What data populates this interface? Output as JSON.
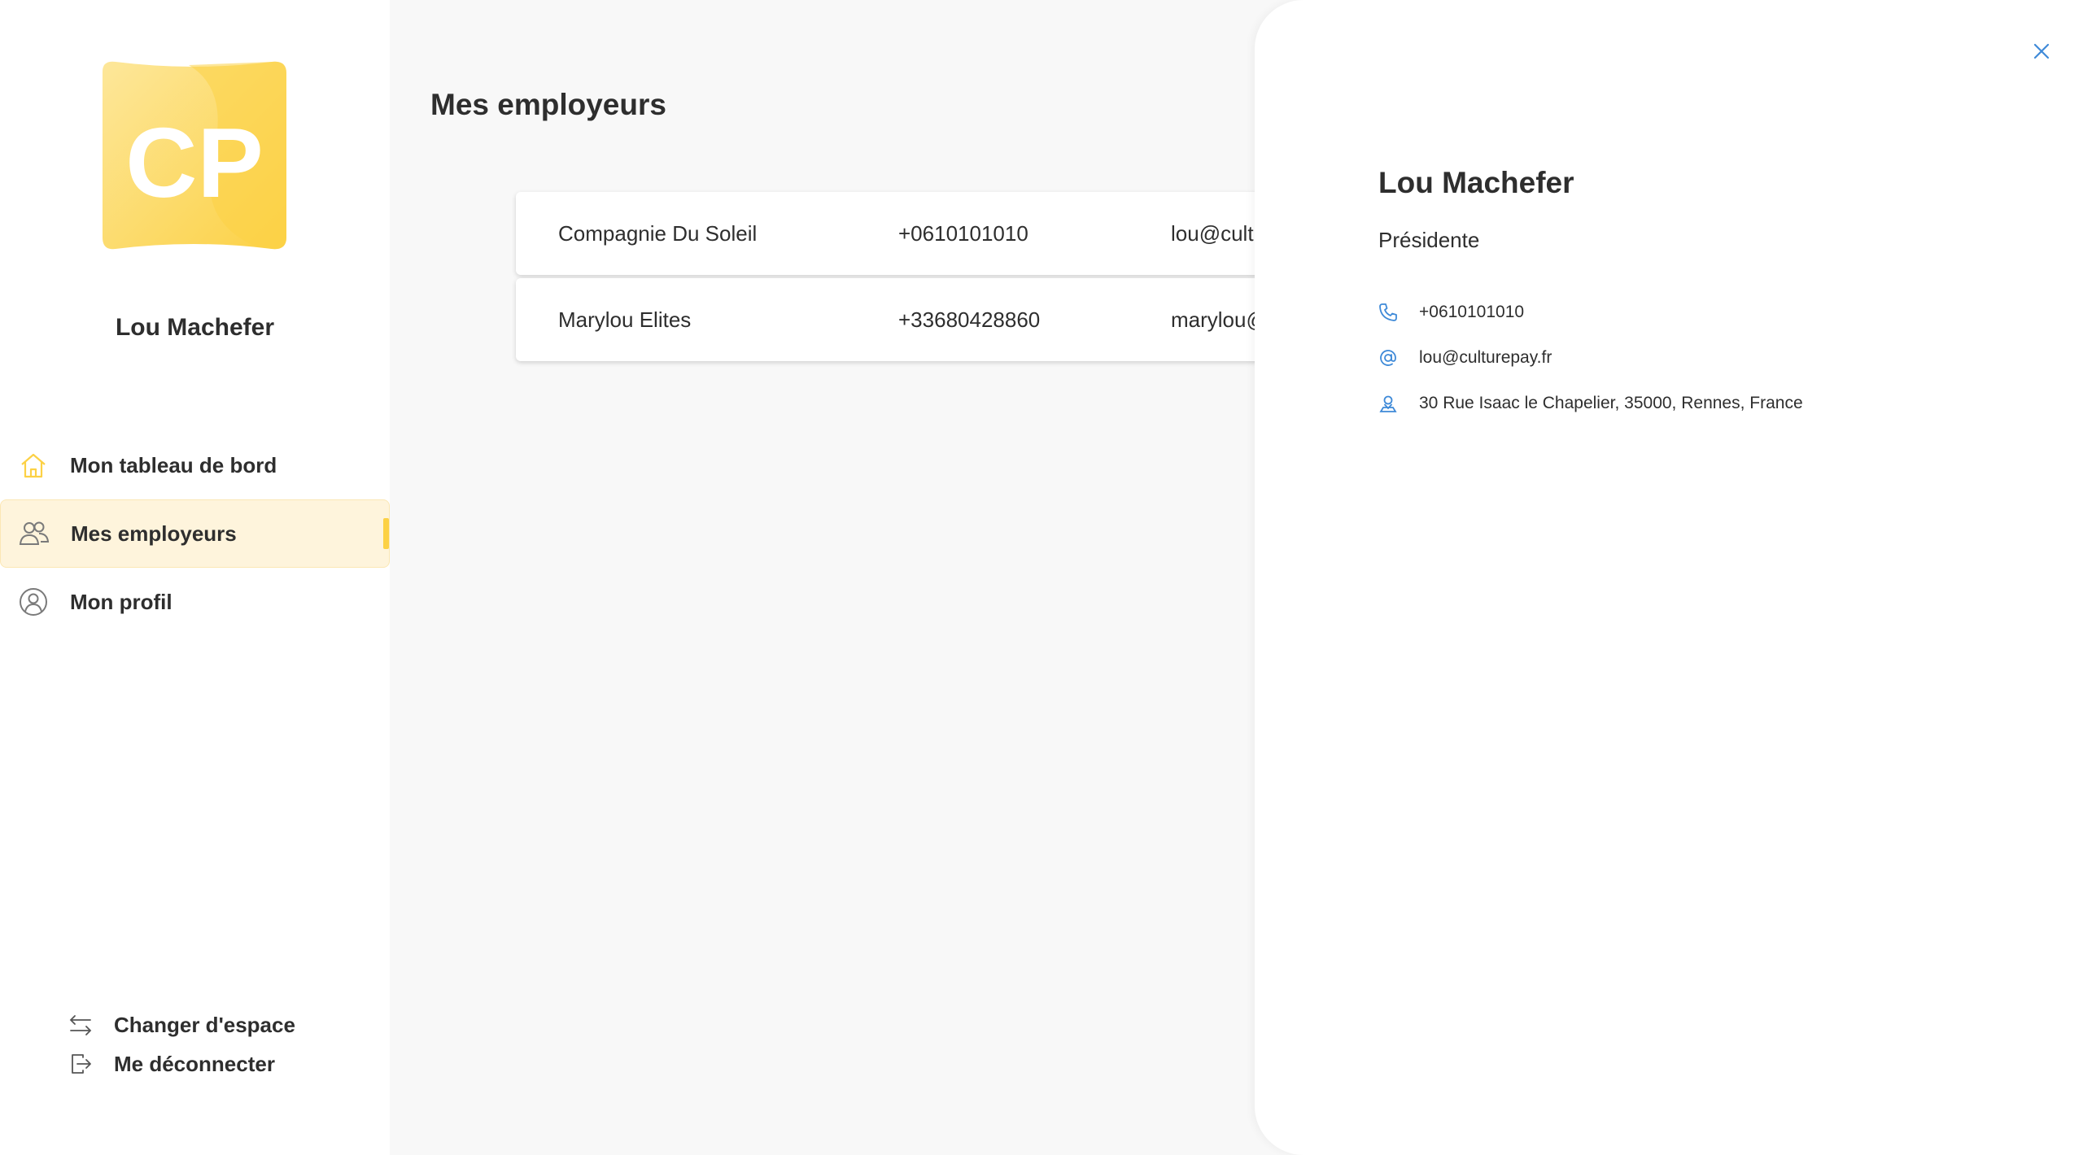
{
  "brand": {
    "logo_text": "CP",
    "accent_color": "#fcd145",
    "info_icon_color": "#3f8ad8"
  },
  "sidebar": {
    "user_name": "Lou Machefer",
    "items": [
      {
        "label": "Mon tableau de bord",
        "icon": "home-icon",
        "active": false
      },
      {
        "label": "Mes employeurs",
        "icon": "users-icon",
        "active": true
      },
      {
        "label": "Mon profil",
        "icon": "user-circle-icon",
        "active": false
      }
    ],
    "actions": [
      {
        "label": "Changer d'espace",
        "icon": "switch-arrows-icon"
      },
      {
        "label": "Me déconnecter",
        "icon": "logout-icon"
      }
    ]
  },
  "main": {
    "title": "Mes employeurs",
    "rows": [
      {
        "name": "Compagnie Du Soleil",
        "phone": "+0610101010",
        "email": "lou@cult"
      },
      {
        "name": "Marylou Elites",
        "phone": "+33680428860",
        "email": "marylou@"
      }
    ]
  },
  "drawer": {
    "name": "Lou Machefer",
    "role": "Présidente",
    "phone": "+0610101010",
    "email": "lou@culturepay.fr",
    "address": "30 Rue Isaac le Chapelier, 35000, Rennes, France"
  }
}
